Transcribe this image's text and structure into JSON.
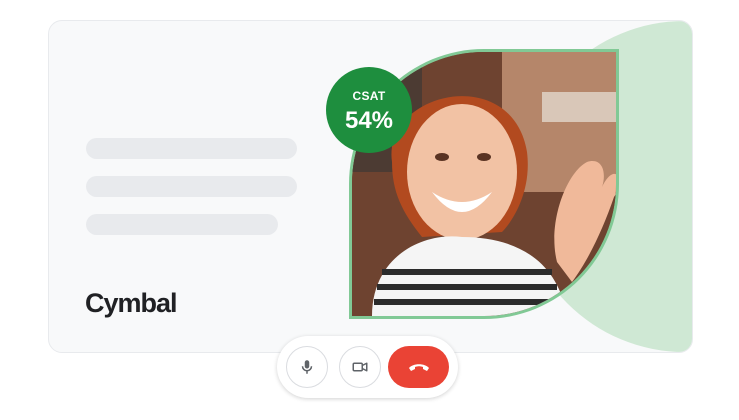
{
  "brand": {
    "name": "Cymbal"
  },
  "csat": {
    "label": "CSAT",
    "value": "54%"
  },
  "controls": {
    "mic_icon": "mic-icon",
    "camera_icon": "video-camera-icon",
    "hangup_icon": "phone-hangup-icon"
  },
  "colors": {
    "accent_green": "#1e8e3e",
    "frame_green": "#81c995",
    "blob_green": "#cfe8d4",
    "hangup_red": "#ea4335"
  }
}
